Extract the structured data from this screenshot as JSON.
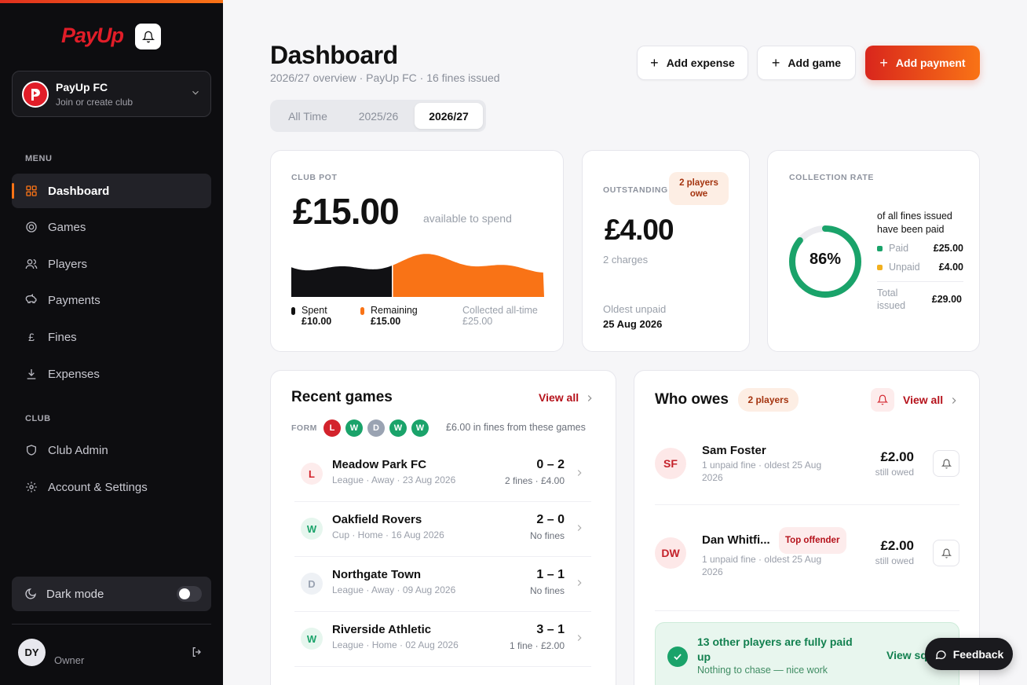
{
  "sidebar": {
    "logo": "PayUp",
    "club": {
      "name": "PayUp FC",
      "sub": "Join or create club"
    },
    "menu_label": "MENU",
    "menu": [
      {
        "label": "Dashboard",
        "icon": "grid-icon",
        "active": true
      },
      {
        "label": "Games",
        "icon": "target-icon"
      },
      {
        "label": "Players",
        "icon": "users-icon"
      },
      {
        "label": "Payments",
        "icon": "piggy-bank-icon"
      },
      {
        "label": "Fines",
        "icon": "pound-icon"
      },
      {
        "label": "Expenses",
        "icon": "download-icon"
      }
    ],
    "club_label": "CLUB",
    "club_menu": [
      {
        "label": "Club Admin",
        "icon": "shield-icon"
      },
      {
        "label": "Account & Settings",
        "icon": "gear-icon"
      }
    ],
    "dark_mode": "Dark mode",
    "user": {
      "initials": "DY",
      "role": "Owner"
    }
  },
  "header": {
    "title": "Dashboard",
    "subtitle": "2026/27 overview · PayUp FC · 16 fines issued",
    "add_expense": "Add expense",
    "add_game": "Add game",
    "add_payment": "Add payment"
  },
  "seasons": [
    "All Time",
    "2025/26",
    "2026/27"
  ],
  "season_selected": "2026/27",
  "pot": {
    "label": "CLUB POT",
    "amount": "£15.00",
    "sub": "available to spend",
    "spent_label": "Spent",
    "spent": "£10.00",
    "remaining_label": "Remaining",
    "remaining": "£15.00",
    "collected_label": "Collected all-time",
    "collected": "£25.00",
    "spent_fraction": 0.4
  },
  "outstanding": {
    "label": "OUTSTANDING",
    "badge": "2 players owe",
    "amount": "£4.00",
    "charges": "2 charges",
    "oldest_label": "Oldest unpaid",
    "oldest_date": "25 Aug 2026"
  },
  "collection": {
    "label": "COLLECTION RATE",
    "percent": "86%",
    "fraction": 0.86,
    "desc": "of all fines issued have been paid",
    "paid_label": "Paid",
    "paid": "£25.00",
    "unpaid_label": "Unpaid",
    "unpaid": "£4.00",
    "total_label": "Total issued",
    "total": "£29.00"
  },
  "recent_games": {
    "title": "Recent games",
    "view_all": "View all",
    "form_label": "FORM",
    "form": [
      "L",
      "W",
      "D",
      "W",
      "W"
    ],
    "fines_note": "£6.00 in fines from these games",
    "games": [
      {
        "result": "L",
        "name": "Meadow Park FC",
        "meta": "League · Away · 23 Aug 2026",
        "score": "0 – 2",
        "fines": "2 fines · £4.00"
      },
      {
        "result": "W",
        "name": "Oakfield Rovers",
        "meta": "Cup · Home · 16 Aug 2026",
        "score": "2 – 0",
        "fines": "No fines"
      },
      {
        "result": "D",
        "name": "Northgate Town",
        "meta": "League · Away · 09 Aug 2026",
        "score": "1 – 1",
        "fines": "No fines"
      },
      {
        "result": "W",
        "name": "Riverside Athletic",
        "meta": "League · Home · 02 Aug 2026",
        "score": "3 – 1",
        "fines": "1 fine · £2.00"
      }
    ]
  },
  "who_owes": {
    "title": "Who owes",
    "badge": "2 players",
    "view_all": "View all",
    "rows": [
      {
        "initials": "SF",
        "name": "Sam Foster",
        "meta": "1 unpaid fine · oldest 25 Aug 2026",
        "amount": "£2.00",
        "still": "still owed"
      },
      {
        "initials": "DW",
        "name": "Dan Whitfi...",
        "tag": "Top offender",
        "meta": "1 unpaid fine · oldest 25 Aug 2026",
        "amount": "£2.00",
        "still": "still owed"
      }
    ],
    "paid_banner": {
      "title": "13 other players are fully paid up",
      "sub": "Nothing to chase — nice work",
      "link": "View sq"
    }
  },
  "feedback": "Feedback"
}
